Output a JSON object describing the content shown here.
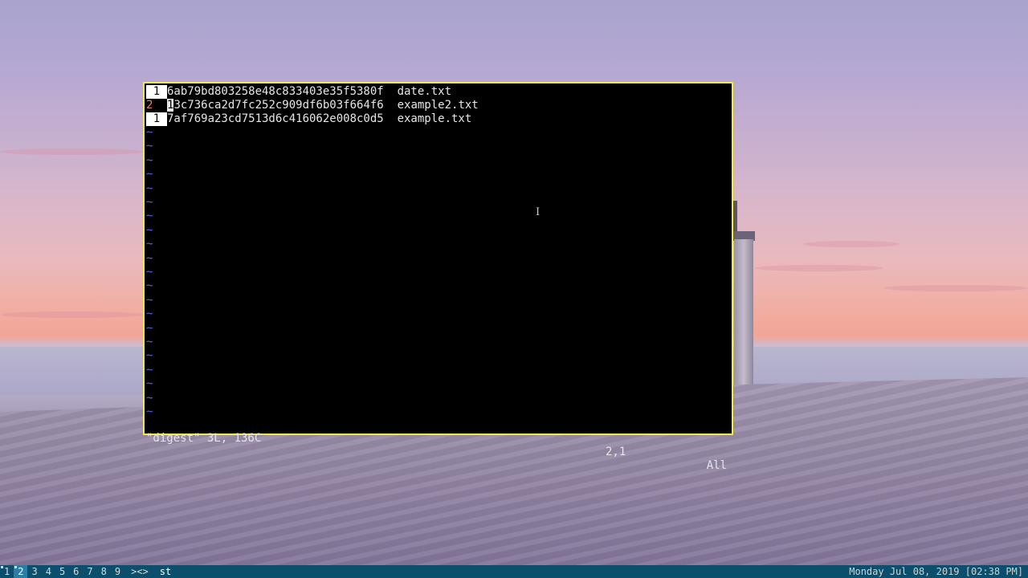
{
  "terminal": {
    "lines": [
      {
        "num": "1",
        "hash": "6ab79bd803258e48c833403e35f5380f",
        "file": "date.txt"
      },
      {
        "num": "2",
        "cursor_char": "1",
        "hash_rest": "3c736ca2d7fc252c909df6b03f664f6",
        "file": "example2.txt"
      },
      {
        "num": "1",
        "hash": "7af769a23cd7513d6c416062e008c0d5",
        "file": "example.txt"
      }
    ],
    "tilde": "~",
    "status": {
      "file_info": "\"digest\" 3L, 136C",
      "position": "2,1",
      "scroll": "All"
    }
  },
  "mouse_cursor": "I",
  "bar": {
    "tags": [
      "1",
      "2",
      "3",
      "4",
      "5",
      "6",
      "7",
      "8",
      "9"
    ],
    "selected_tag": "2",
    "layout": "><>",
    "window_title": "st",
    "clock": "Monday Jul 08, 2019 [02:38 PM]"
  },
  "colors": {
    "border": "#f2e84a",
    "bar_bg": "#0b4f6c",
    "tilde": "#5a62e6",
    "current_line_number": "#e5894a"
  }
}
